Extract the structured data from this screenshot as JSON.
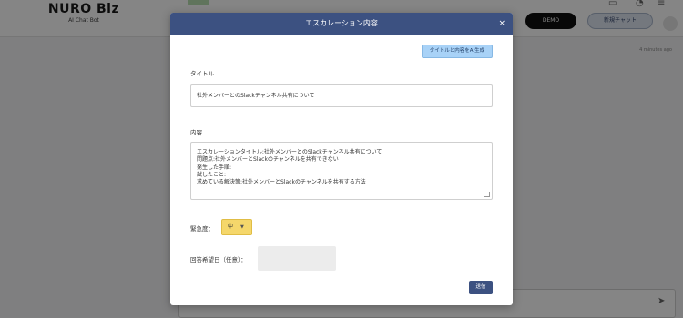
{
  "background": {
    "logo_main": "NURO Biz",
    "logo_sub": "AI Chat Bot",
    "pill_dark": "DEMO",
    "pill_light": "新規チャット",
    "meta_text": "4 minutes ago"
  },
  "modal": {
    "title": "エスカレーション内容",
    "close": "×",
    "ai_button": "タイトルと内容をAI生成",
    "title_label": "タイトル",
    "title_value": "社外メンバーとのSlackチャンネル共有について",
    "content_label": "内容",
    "content_lines": [
      "エスカレーションタイトル:社外メンバーとのSlackチャンネル共有について",
      "問題点:社外メンバーとSlackのチャンネルを共有できない",
      "発生した手順:",
      "試したこと:",
      "求めている解決策:社外メンバーとSlackのチャンネルを共有する方法"
    ],
    "urgency_label": "緊急度：",
    "urgency_value": "中",
    "urgency_caret": "▼",
    "date_label": "回答希望日（任意）：",
    "send_button": "送信"
  },
  "colors": {
    "header": "#3c5181",
    "ai_button": "#a8d2f7",
    "urgency": "#f5d76b",
    "send_button": "#3c5181"
  }
}
